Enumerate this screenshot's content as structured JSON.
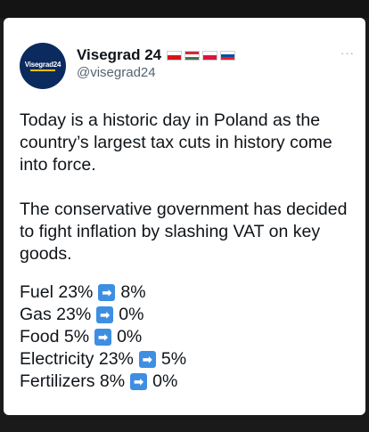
{
  "author": {
    "display_name": "Visegrad 24",
    "handle": "@visegrad24",
    "avatar_text": "Visegrad24",
    "flags": [
      {
        "country": "Czechia",
        "colors": [
          "#ffffff",
          "#d7141a",
          "#11457e"
        ]
      },
      {
        "country": "Hungary",
        "colors": [
          "#ce2939",
          "#ffffff",
          "#477050"
        ]
      },
      {
        "country": "Poland",
        "colors": [
          "#ffffff",
          "#dc143c"
        ]
      },
      {
        "country": "Slovakia",
        "colors": [
          "#ffffff",
          "#0b4ea2",
          "#ee1c25"
        ]
      }
    ]
  },
  "more_label": "···",
  "tweet": {
    "paragraph1": "Today is a historic day in Poland as the country’s largest tax cuts in history come into force.",
    "paragraph2": "The conservative government has decided to fight inflation by slashing VAT on key goods.",
    "items": [
      {
        "label": "Fuel 23%",
        "arrow": "➡",
        "value": "8%"
      },
      {
        "label": "Gas 23%",
        "arrow": "➡",
        "value": "0%"
      },
      {
        "label": "Food 5%",
        "arrow": "➡",
        "value": "0%"
      },
      {
        "label": "Electricity 23%",
        "arrow": "➡",
        "value": "5%"
      },
      {
        "label": "Fertilizers 8%",
        "arrow": "➡",
        "value": "0%"
      }
    ]
  },
  "colors": {
    "arrow_button": "#3e8ee2",
    "avatar_bg": "#0b2a5e",
    "handle_text": "#536471"
  }
}
